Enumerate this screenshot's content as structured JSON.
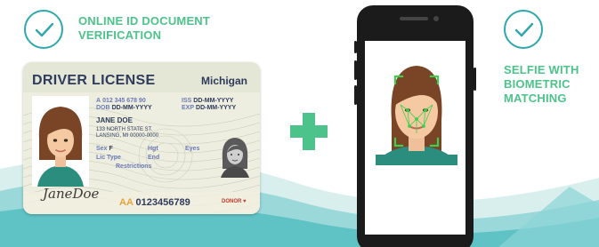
{
  "left_caption": {
    "line1": "ONLINE ID DOCUMENT",
    "line2": "VERIFICATION",
    "icon": "check-circle-icon"
  },
  "right_caption": {
    "line1": "SELFIE WITH",
    "line2": "BIOMETRIC",
    "line3": "MATCHING",
    "icon": "check-circle-icon"
  },
  "card": {
    "title": "DRIVER LICENSE",
    "state": "Michigan",
    "id_label": "A",
    "id_value": "012 345 678 90",
    "dob_label": "DOB",
    "dob_value": "DD-MM-YYYY",
    "iss_label": "ISS",
    "iss_value": "DD-MM-YYYY",
    "exp_label": "EXP",
    "exp_value": "DD-MM-YYYY",
    "name": "JANE DOE",
    "address1": "133 NORTH STATE ST.",
    "address2": "LANSING, MI 00000-0000",
    "sex_label": "Sex",
    "sex_value": "F",
    "hgt_label": "Hgt",
    "eyes_label": "Eyes",
    "lic_type_label": "Lic Type",
    "end_label": "End",
    "restrictions_label": "Restrictions",
    "signature": "JaneDoe",
    "number_prefix": "AA",
    "number": "0123456789",
    "donor_label": "DONOR"
  },
  "colors": {
    "accent_green": "#4cc38a",
    "accent_teal": "#2ea7ad",
    "card_text": "#2e3b5c",
    "face_box": "#3fcf4f"
  }
}
